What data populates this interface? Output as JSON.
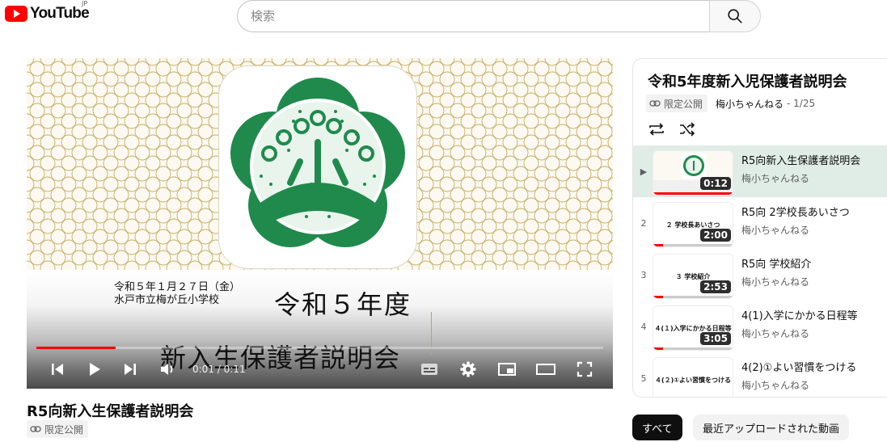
{
  "header": {
    "logo_text": "YouTube",
    "logo_country": "JP",
    "search_placeholder": "検索"
  },
  "player": {
    "slide": {
      "date_line1": "令和５年１月２７日（金）",
      "date_line2": "水戸市立梅が丘小学校",
      "title_line1": "令和５年度",
      "title_line2": "新入生保護者説明会"
    },
    "time_current": "0:01",
    "time_separator": "/",
    "time_total": "0:11",
    "progress_fraction": 0.14
  },
  "video": {
    "title": "R5向新入生保護者説明会",
    "visibility": "限定公開"
  },
  "playlist": {
    "title": "令和5年度新入児保護者説明会",
    "visibility": "限定公開",
    "channel": "梅小ちゃんねる",
    "position": "- 1/25",
    "items": [
      {
        "index": "▶",
        "title": "R5向新入生保護者説明会",
        "channel": "梅小ちゃんねる",
        "duration": "0:12",
        "thumb_text": "",
        "watched_fraction": 1.0,
        "active": true
      },
      {
        "index": "2",
        "title": "R5向 2学校長あいさつ",
        "channel": "梅小ちゃんねる",
        "duration": "2:00",
        "thumb_text": "２ 学校長あいさつ",
        "watched_fraction": 0.12,
        "active": false
      },
      {
        "index": "3",
        "title": "R5向 学校紹介",
        "channel": "梅小ちゃんねる",
        "duration": "2:53",
        "thumb_text": "３ 学校紹介",
        "watched_fraction": 0.12,
        "active": false
      },
      {
        "index": "4",
        "title": "4(1)入学にかかる日程等",
        "channel": "梅小ちゃんねる",
        "duration": "3:05",
        "thumb_text": "４(１)入学にかかる日程等",
        "watched_fraction": 0.12,
        "active": false
      },
      {
        "index": "5",
        "title": "4(2)①よい習慣をつける",
        "channel": "梅小ちゃんねる",
        "duration": "",
        "thumb_text": "４(２)①よい習慣をつける",
        "watched_fraction": 0,
        "active": false
      }
    ]
  },
  "chips": {
    "all": "すべて",
    "recent": "最近アップロードされた動画"
  },
  "colors": {
    "brand_red": "#ff0000",
    "emblem_green": "#1f8a4c",
    "pattern_gold": "#c9ad62",
    "active_row": "#e0ede6"
  }
}
